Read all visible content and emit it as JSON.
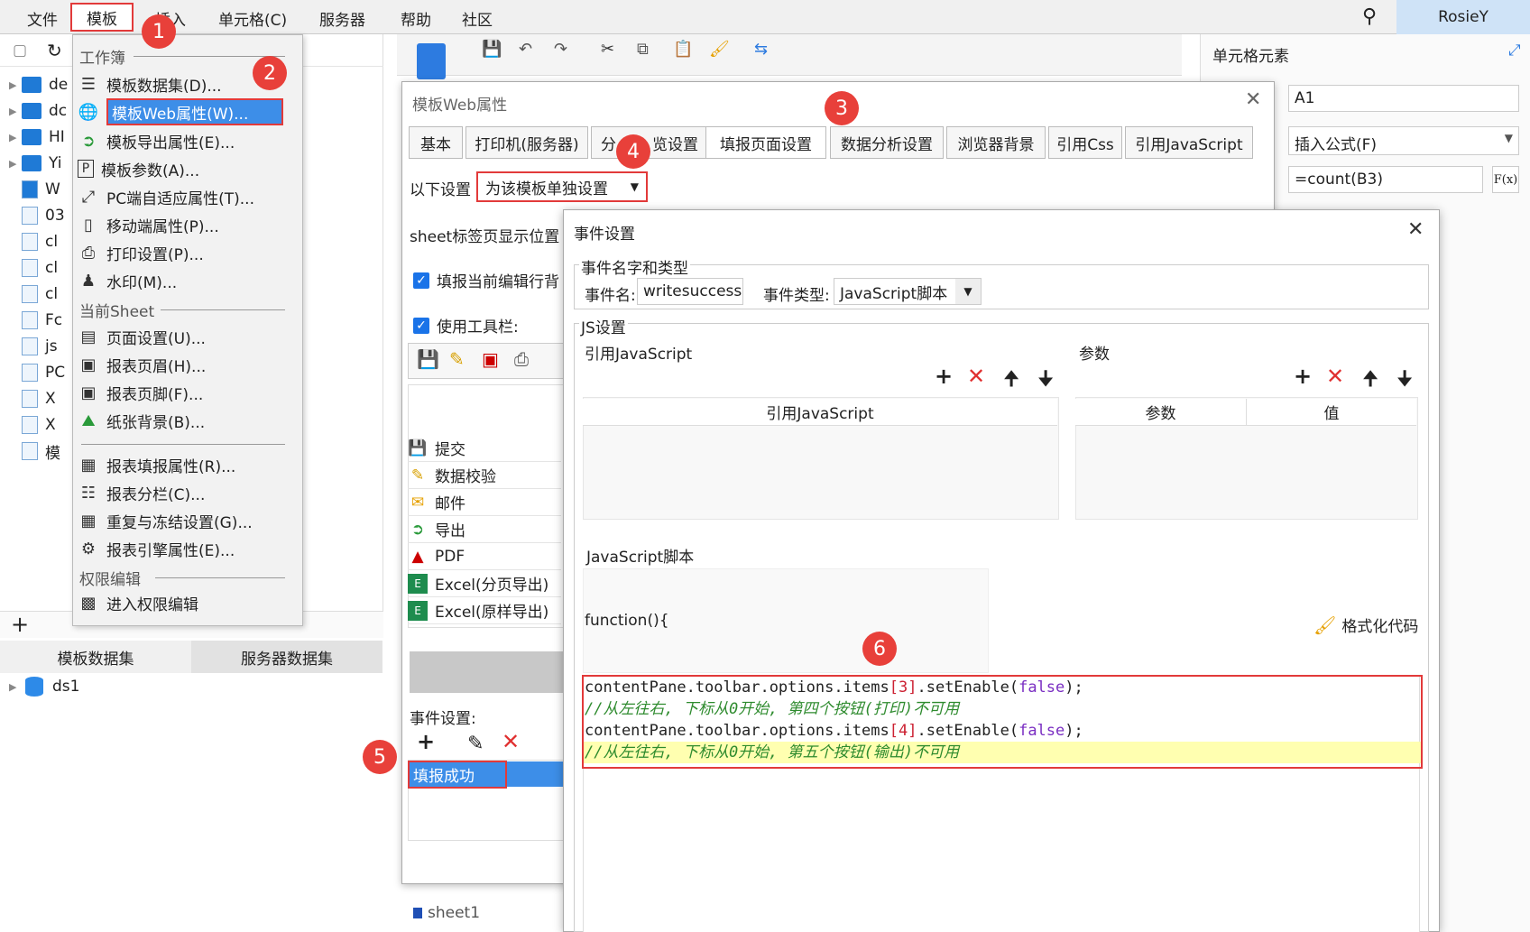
{
  "menubar": {
    "items": [
      "文件",
      "模板",
      "插入",
      "单元格(C)",
      "服务器",
      "帮助",
      "社区"
    ],
    "user": "RosieY"
  },
  "template_menu": {
    "section_workbook": "工作簿",
    "workbook_items": [
      "模板数据集(D)...",
      "模板Web属性(W)...",
      "模板导出属性(E)...",
      "模板参数(A)...",
      "PC端自适应属性(T)...",
      "移动端属性(P)...",
      "打印设置(P)...",
      "水印(M)..."
    ],
    "section_sheet": "当前Sheet",
    "sheet_items": [
      "页面设置(U)...",
      "报表页眉(H)...",
      "报表页脚(F)...",
      "纸张背景(B)...",
      "报表填报属性(R)...",
      "报表分栏(C)...",
      "重复与冻结设置(G)...",
      "报表引擎属性(E)..."
    ],
    "section_permission": "权限编辑",
    "permission_items": [
      "进入权限编辑"
    ]
  },
  "left_tree": {
    "items": [
      "de",
      "dc",
      "HI",
      "Yi",
      "W",
      "03",
      "cl",
      "cl",
      "cl",
      "Fc",
      "js",
      "PC",
      "X",
      "X",
      "模"
    ]
  },
  "dataset_panel": {
    "tabs": [
      "模板数据集",
      "服务器数据集"
    ],
    "items": [
      "ds1"
    ]
  },
  "right_panel": {
    "title": "单元格元素",
    "cell": "A1",
    "insert_formula": "插入公式(F)",
    "formula": "=count(B3)",
    "fx_label": "F(x)"
  },
  "web_dialog": {
    "title": "模板Web属性",
    "tabs": [
      "基本",
      "打印机(服务器)",
      "分页预览设置",
      "填报页面设置",
      "数据分析设置",
      "浏览器背景",
      "引用Css",
      "引用JavaScript"
    ],
    "tab_partial_label": "分",
    "tab_partial_suffix": "览设置",
    "setting_label": "以下设置",
    "setting_value": "为该模板单独设置",
    "sheet_tab_label": "sheet标签页显示位置",
    "fill_current_row": "填报当前编辑行背",
    "use_toolbar": "使用工具栏:",
    "toolbar_buttons": [
      "提交",
      "数据校验",
      "邮件",
      "导出",
      "PDF",
      "Excel(分页导出)",
      "Excel(原样导出)"
    ],
    "event_label": "事件设置:",
    "event_items": [
      "填报成功"
    ],
    "sheet_tab": "sheet1"
  },
  "event_dialog": {
    "title": "事件设置",
    "name_type_legend": "事件名字和类型",
    "event_name_label": "事件名:",
    "event_name_value": "writesuccess",
    "event_type_label": "事件类型:",
    "event_type_value": "JavaScript脚本",
    "js_settings_legend": "JS设置",
    "ref_js_legend": "引用JavaScript",
    "ref_js_header": "引用JavaScript",
    "params_legend": "参数",
    "params_headers": [
      "参数",
      "值"
    ],
    "script_legend": "JavaScript脚本",
    "function_header": "function(){",
    "format_code": "格式化代码",
    "code_lines": [
      {
        "code": "contentPane.toolbar.options.items[3].setEnable(false);",
        "comment": false
      },
      {
        "code": "//从左往右, 下标从0开始, 第四个按钮(打印)不可用",
        "comment": true
      },
      {
        "code": "contentPane.toolbar.options.items[4].setEnable(false);",
        "comment": false
      },
      {
        "code": "//从左往右, 下标从0开始, 第五个按钮(输出)不可用",
        "comment": true
      }
    ]
  },
  "badges": [
    "1",
    "2",
    "3",
    "4",
    "5",
    "6"
  ],
  "colors": {
    "accent": "#1a73e8",
    "highlight": "#e23a3a",
    "selection": "#3d8ee8",
    "code_highlight": "#ffffb0"
  }
}
